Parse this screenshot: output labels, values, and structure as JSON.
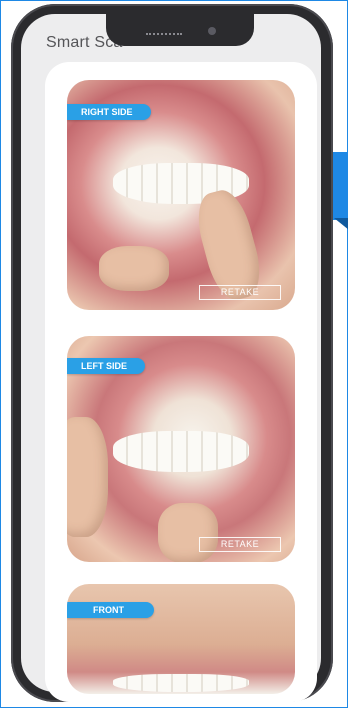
{
  "app": {
    "title": "Smart Sca"
  },
  "scans": [
    {
      "label": "RIGHT SIDE",
      "action": "RETAKE"
    },
    {
      "label": "LEFT SIDE",
      "action": "RETAKE"
    },
    {
      "label": "FRONT"
    }
  ],
  "colors": {
    "accent": "#2aa0e6",
    "tab_blue": "#1e88e5",
    "phone_body": "#2b2b2e",
    "screen_bg": "#ededee"
  }
}
